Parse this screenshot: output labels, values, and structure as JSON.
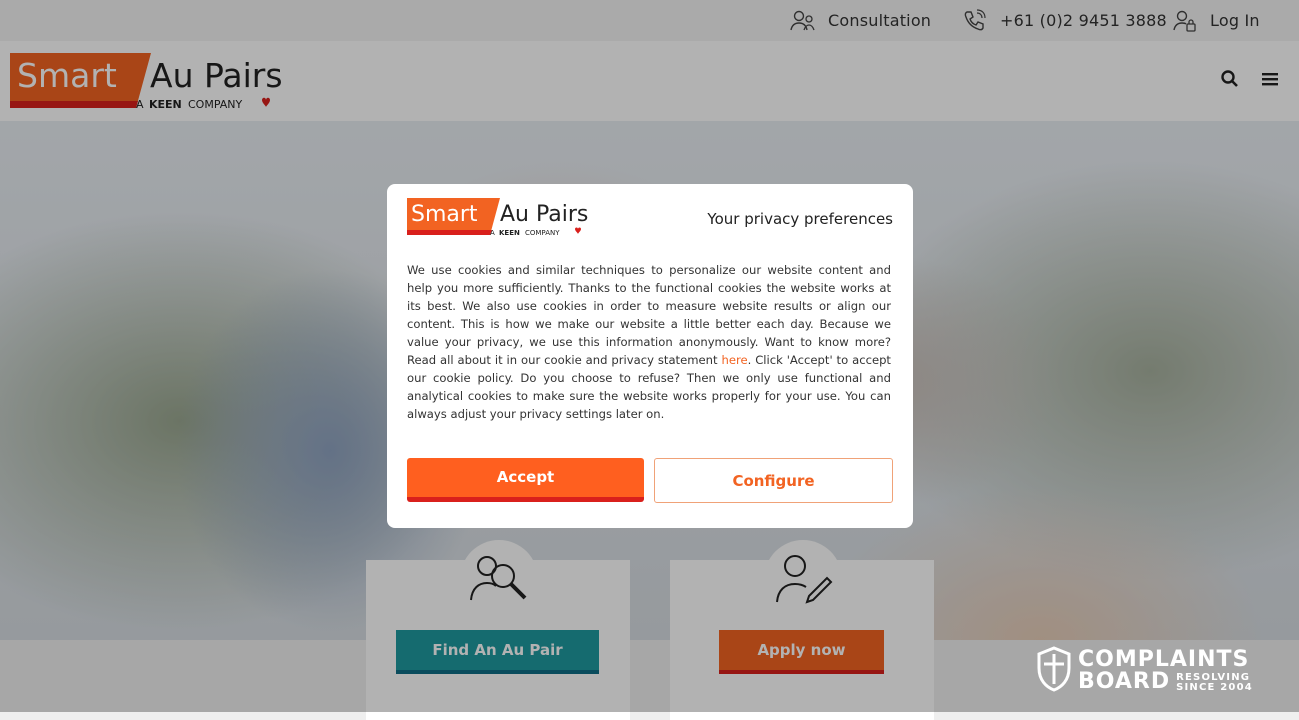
{
  "topbar": {
    "consultation": "Consultation",
    "phone": "+61 (0)2 9451 3888",
    "login": "Log In"
  },
  "brand": {
    "word1": "Smart",
    "word2": "Au Pairs",
    "tagline_prefix": "A",
    "tagline_keen": "KEEN",
    "tagline_suffix": "COMPANY",
    "orange": "#f26322",
    "red": "#d9201c"
  },
  "header": {
    "search_icon": "search-icon",
    "menu_icon": "hamburger-menu-icon"
  },
  "cards": {
    "find_label": "Find An Au Pair",
    "find_color": "#1f9aa0",
    "apply_label": "Apply now",
    "apply_color": "#f26322"
  },
  "badge": {
    "line1": "COMPLAINTS",
    "line2": "BOARD",
    "line3": "RESOLVING",
    "line4": "SINCE 2004"
  },
  "modal": {
    "title": "Your privacy preferences",
    "body_before_link": "We use cookies and similar techniques to personalize our website content and help you more sufficiently. Thanks to the functional cookies the website works at its best. We also use cookies in order to measure website results or align our content. This is how we make our website a little better each day. Because we value your privacy, we use this information anonymously. Want to know more? Read all about it in our cookie and privacy statement ",
    "link": "here",
    "body_after_link": ". Click 'Accept' to accept our cookie policy. Do you choose to refuse? Then we only use functional and analytical cookies to make sure the website works properly for your use. You can always adjust your privacy settings later on.",
    "accept": "Accept",
    "configure": "Configure"
  }
}
